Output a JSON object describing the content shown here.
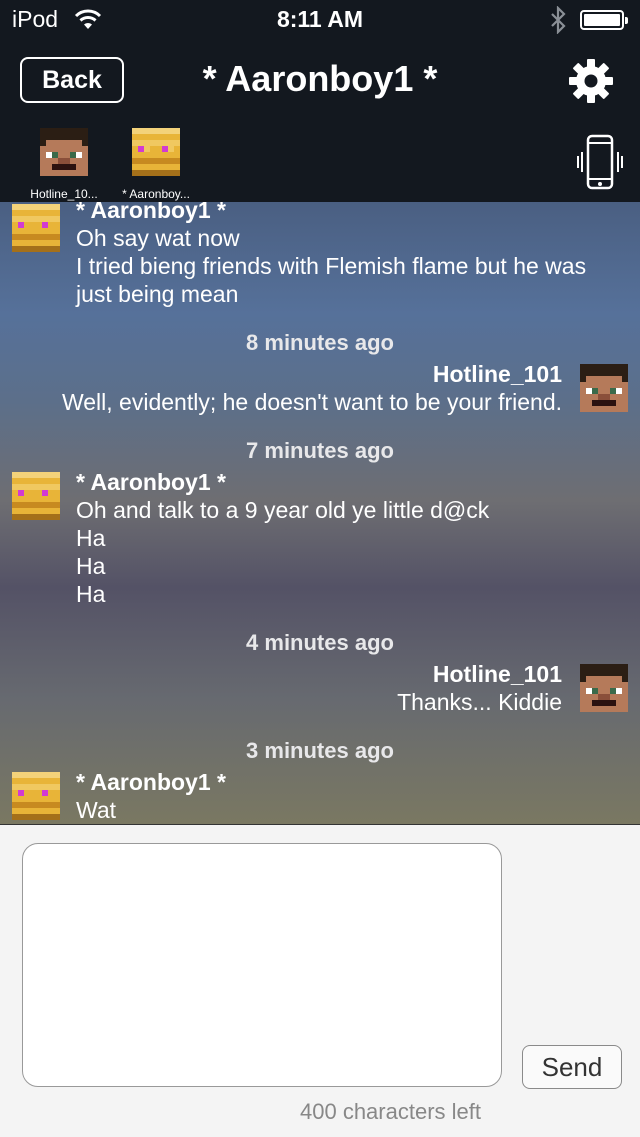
{
  "status_bar": {
    "carrier": "iPod",
    "time": "8:11 AM"
  },
  "header": {
    "back_label": "Back",
    "title": "* Aaronboy1 *",
    "participants": [
      {
        "name": "Hotline_10...",
        "avatar": "steve-face"
      },
      {
        "name": "* Aaronboy...",
        "avatar": "blaze-face"
      }
    ]
  },
  "messages": [
    {
      "side": "left",
      "sender": "* Aaronboy1 *",
      "lines": [
        "Oh say wat now",
        "I tried bieng friends with Flemish flame but he was",
        "just being mean"
      ]
    },
    {
      "type": "timestamp",
      "text": "8 minutes ago"
    },
    {
      "side": "right",
      "sender": "Hotline_101",
      "lines": [
        "Well, evidently; he doesn't want to be your friend."
      ]
    },
    {
      "type": "timestamp",
      "text": "7 minutes ago"
    },
    {
      "side": "left",
      "sender": "* Aaronboy1 *",
      "lines": [
        "Oh and talk to a 9 year old ye little d@ck",
        "Ha",
        "Ha",
        "Ha"
      ]
    },
    {
      "type": "timestamp",
      "text": "4 minutes ago"
    },
    {
      "side": "right",
      "sender": "Hotline_101",
      "lines": [
        "Thanks... Kiddie"
      ]
    },
    {
      "type": "timestamp",
      "text": "3 minutes ago"
    },
    {
      "side": "left",
      "sender": "* Aaronboy1 *",
      "lines": [
        "Wat"
      ]
    }
  ],
  "compose": {
    "input_value": "",
    "send_label": "Send",
    "chars_left": "400 characters left"
  },
  "colors": {
    "header_bg": "#13181f",
    "text_on_dark": "#ffffff"
  }
}
